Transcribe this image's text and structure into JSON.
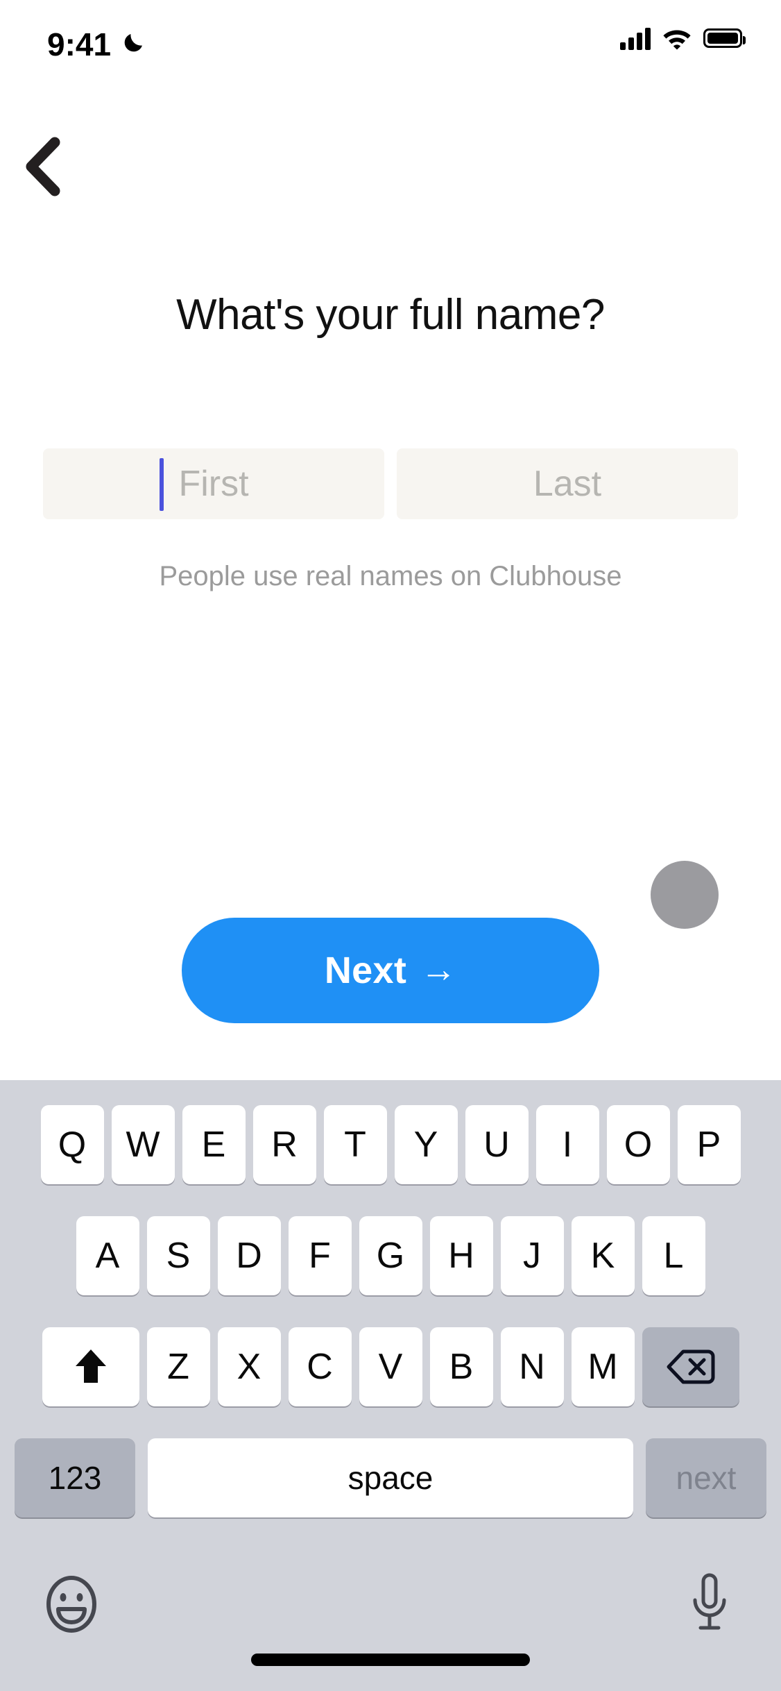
{
  "status_bar": {
    "time": "9:41",
    "dnd_icon": "crescent-moon-icon",
    "cellular_icon": "cellular-signal-icon",
    "wifi_icon": "wifi-icon",
    "battery_icon": "battery-full-icon"
  },
  "nav": {
    "back_icon": "chevron-left-icon"
  },
  "screen": {
    "title": "What's your full name?",
    "helper_text": "People use real names on Clubhouse"
  },
  "form": {
    "first_name": {
      "placeholder": "First",
      "value": "",
      "focused": true,
      "caret_color": "#4b52dd"
    },
    "last_name": {
      "placeholder": "Last",
      "value": "",
      "focused": false
    },
    "field_background": "#f7f5f1"
  },
  "primary_action": {
    "label": "Next",
    "arrow": "→",
    "color": "#1f90f5",
    "text_color": "#ffffff"
  },
  "cursor_indicator": {
    "shape": "circle",
    "color": "#9b9b9f"
  },
  "keyboard": {
    "background": "#d1d3da",
    "row1": [
      "Q",
      "W",
      "E",
      "R",
      "T",
      "Y",
      "U",
      "I",
      "O",
      "P"
    ],
    "row2": [
      "A",
      "S",
      "D",
      "F",
      "G",
      "H",
      "J",
      "K",
      "L"
    ],
    "row3": [
      "Z",
      "X",
      "C",
      "V",
      "B",
      "N",
      "M"
    ],
    "shift_icon": "shift-arrow-up-icon",
    "backspace_icon": "backspace-delete-icon",
    "numbers_key": "123",
    "space_key": "space",
    "return_key": "next",
    "emoji_icon": "emoji-smiley-icon",
    "mic_icon": "microphone-icon"
  },
  "home_indicator": "home-indicator-bar"
}
